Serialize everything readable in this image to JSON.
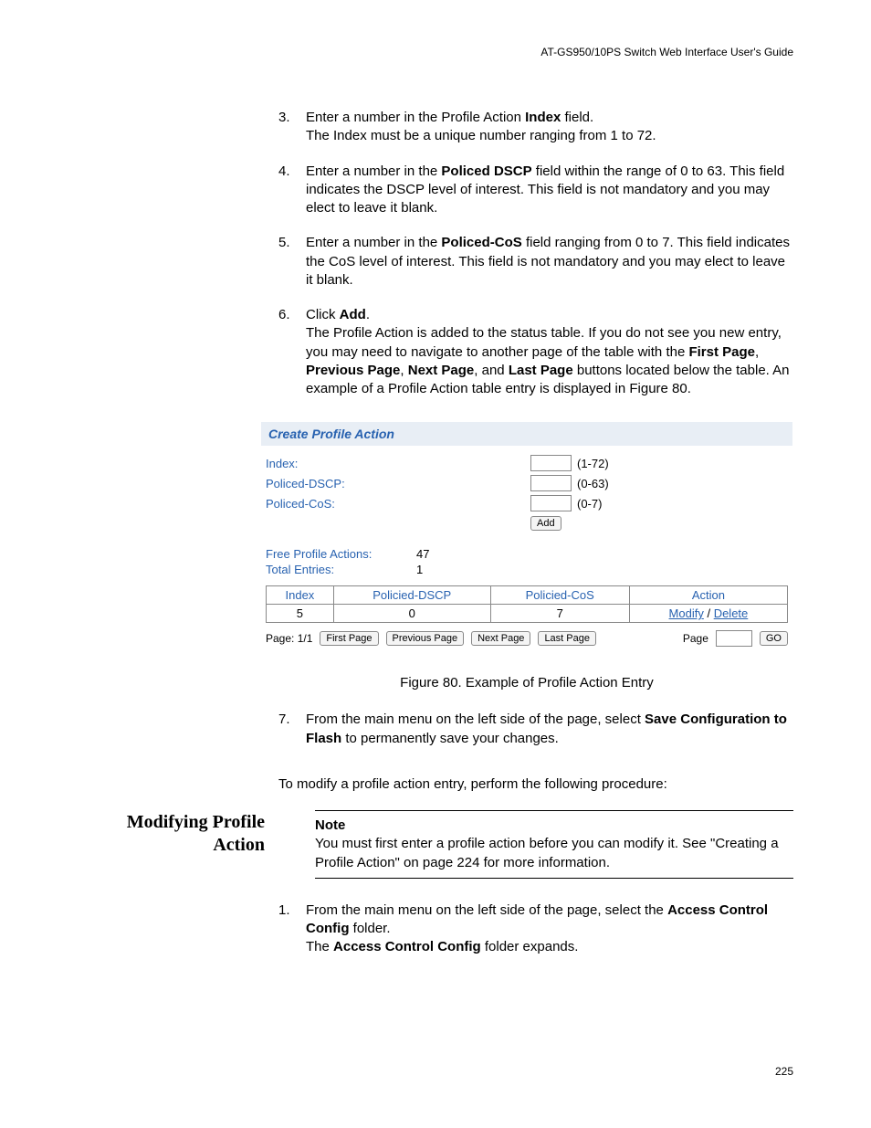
{
  "header": {
    "guide": "AT-GS950/10PS Switch Web Interface User's Guide"
  },
  "steps_top": [
    {
      "n": "3.",
      "pre": "Enter a number in the Profile Action ",
      "b1": "Index",
      "post": " field.\nThe Index must be a unique number ranging from 1 to 72."
    },
    {
      "n": "4.",
      "pre": "Enter a number in the ",
      "b1": "Policed DSCP",
      "post": " field within the range of 0 to 63. This field indicates the DSCP level of interest. This field is not mandatory and you may elect to leave it blank."
    },
    {
      "n": "5.",
      "pre": "Enter a number in the ",
      "b1": "Policed-CoS",
      "post": " field ranging from 0 to 7. This field indicates the CoS level of interest. This field is not mandatory and you may elect to leave it blank."
    }
  ],
  "step6": {
    "n": "6.",
    "lead": "Click ",
    "b1": "Add",
    "tail1": ".\nThe Profile Action is added to the status table. If you do not see you new entry, you may need to navigate to another page of the table with the ",
    "b2": "First Page",
    "sep2": ", ",
    "b3": "Previous Page",
    "sep3": ", ",
    "b4": "Next Page",
    "sep4": ", and ",
    "b5": "Last Page",
    "tail2": " buttons located below the table. An example of a Profile Action table entry is displayed in Figure 80."
  },
  "panel": {
    "title": "Create Profile Action",
    "rows": [
      {
        "label": "Index:",
        "hint": "(1-72)"
      },
      {
        "label": "Policed-DSCP:",
        "hint": "(0-63)"
      },
      {
        "label": "Policed-CoS:",
        "hint": "(0-7)"
      }
    ],
    "add_label": "Add",
    "stats": [
      {
        "label": "Free Profile Actions:",
        "val": "47"
      },
      {
        "label": "Total Entries:",
        "val": "1"
      }
    ],
    "table": {
      "headers": [
        "Index",
        "Policied-DSCP",
        "Policied-CoS",
        "Action"
      ],
      "row": {
        "index": "5",
        "dscp": "0",
        "cos": "7",
        "modify": "Modify",
        "sep": " / ",
        "delete": "Delete"
      }
    },
    "pager": {
      "page_label": "Page: 1/1",
      "first": "First Page",
      "prev": "Previous Page",
      "next": "Next Page",
      "last": "Last Page",
      "page_word": "Page",
      "go": "GO"
    }
  },
  "figure_caption": "Figure 80. Example of Profile Action Entry",
  "step7": {
    "n": "7.",
    "pre": "From the main menu on the left side of the page, select ",
    "b1": "Save Configuration to Flash",
    "post": " to permanently save your changes."
  },
  "sidebar_heading": "Modifying Profile Action",
  "modify_intro": "To modify a profile action entry, perform the following procedure:",
  "note": {
    "label": "Note",
    "body": "You must first enter a profile action before you can modify it. See \"Creating a Profile Action\" on page 224 for more information."
  },
  "step_m1": {
    "n": "1.",
    "pre": "From the main menu on the left side of the page, select the ",
    "b1": "Access Control Config",
    "mid": " folder.\nThe ",
    "b2": "Access Control Config",
    "post": " folder expands."
  },
  "page_number": "225"
}
